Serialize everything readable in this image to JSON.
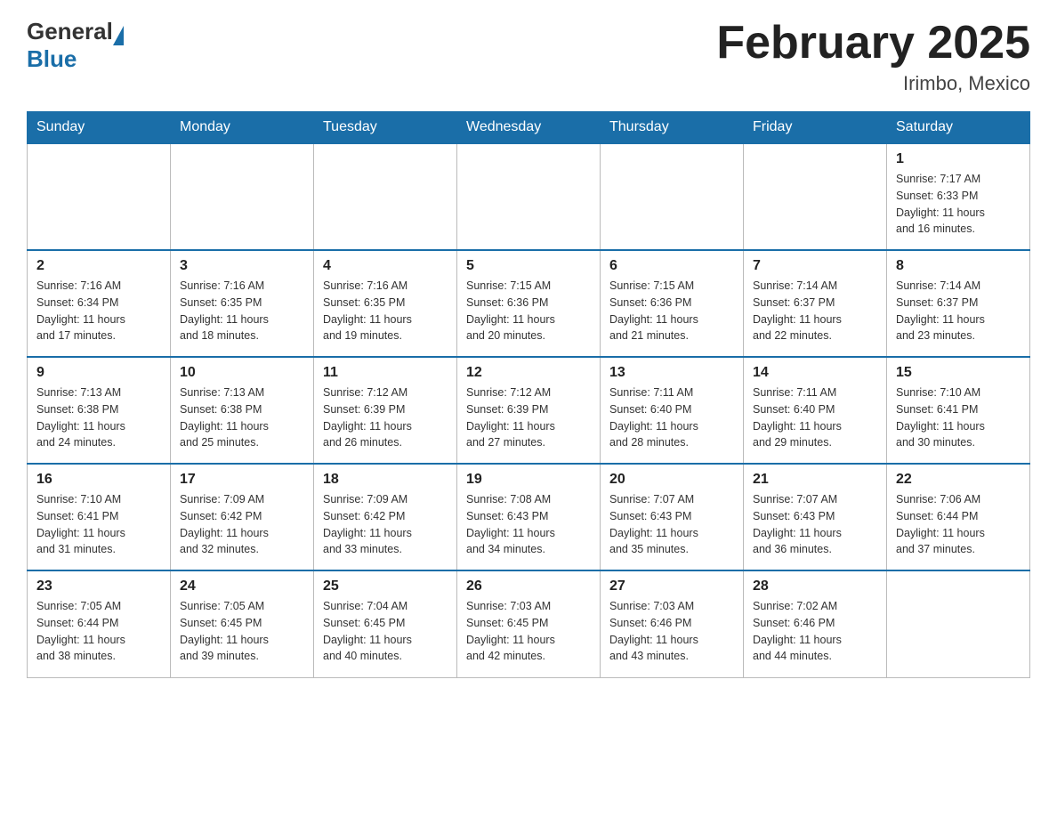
{
  "header": {
    "title": "February 2025",
    "subtitle": "Irimbo, Mexico",
    "logo_general": "General",
    "logo_blue": "Blue"
  },
  "days_of_week": [
    "Sunday",
    "Monday",
    "Tuesday",
    "Wednesday",
    "Thursday",
    "Friday",
    "Saturday"
  ],
  "weeks": [
    [
      {
        "day": "",
        "info": ""
      },
      {
        "day": "",
        "info": ""
      },
      {
        "day": "",
        "info": ""
      },
      {
        "day": "",
        "info": ""
      },
      {
        "day": "",
        "info": ""
      },
      {
        "day": "",
        "info": ""
      },
      {
        "day": "1",
        "info": "Sunrise: 7:17 AM\nSunset: 6:33 PM\nDaylight: 11 hours\nand 16 minutes."
      }
    ],
    [
      {
        "day": "2",
        "info": "Sunrise: 7:16 AM\nSunset: 6:34 PM\nDaylight: 11 hours\nand 17 minutes."
      },
      {
        "day": "3",
        "info": "Sunrise: 7:16 AM\nSunset: 6:35 PM\nDaylight: 11 hours\nand 18 minutes."
      },
      {
        "day": "4",
        "info": "Sunrise: 7:16 AM\nSunset: 6:35 PM\nDaylight: 11 hours\nand 19 minutes."
      },
      {
        "day": "5",
        "info": "Sunrise: 7:15 AM\nSunset: 6:36 PM\nDaylight: 11 hours\nand 20 minutes."
      },
      {
        "day": "6",
        "info": "Sunrise: 7:15 AM\nSunset: 6:36 PM\nDaylight: 11 hours\nand 21 minutes."
      },
      {
        "day": "7",
        "info": "Sunrise: 7:14 AM\nSunset: 6:37 PM\nDaylight: 11 hours\nand 22 minutes."
      },
      {
        "day": "8",
        "info": "Sunrise: 7:14 AM\nSunset: 6:37 PM\nDaylight: 11 hours\nand 23 minutes."
      }
    ],
    [
      {
        "day": "9",
        "info": "Sunrise: 7:13 AM\nSunset: 6:38 PM\nDaylight: 11 hours\nand 24 minutes."
      },
      {
        "day": "10",
        "info": "Sunrise: 7:13 AM\nSunset: 6:38 PM\nDaylight: 11 hours\nand 25 minutes."
      },
      {
        "day": "11",
        "info": "Sunrise: 7:12 AM\nSunset: 6:39 PM\nDaylight: 11 hours\nand 26 minutes."
      },
      {
        "day": "12",
        "info": "Sunrise: 7:12 AM\nSunset: 6:39 PM\nDaylight: 11 hours\nand 27 minutes."
      },
      {
        "day": "13",
        "info": "Sunrise: 7:11 AM\nSunset: 6:40 PM\nDaylight: 11 hours\nand 28 minutes."
      },
      {
        "day": "14",
        "info": "Sunrise: 7:11 AM\nSunset: 6:40 PM\nDaylight: 11 hours\nand 29 minutes."
      },
      {
        "day": "15",
        "info": "Sunrise: 7:10 AM\nSunset: 6:41 PM\nDaylight: 11 hours\nand 30 minutes."
      }
    ],
    [
      {
        "day": "16",
        "info": "Sunrise: 7:10 AM\nSunset: 6:41 PM\nDaylight: 11 hours\nand 31 minutes."
      },
      {
        "day": "17",
        "info": "Sunrise: 7:09 AM\nSunset: 6:42 PM\nDaylight: 11 hours\nand 32 minutes."
      },
      {
        "day": "18",
        "info": "Sunrise: 7:09 AM\nSunset: 6:42 PM\nDaylight: 11 hours\nand 33 minutes."
      },
      {
        "day": "19",
        "info": "Sunrise: 7:08 AM\nSunset: 6:43 PM\nDaylight: 11 hours\nand 34 minutes."
      },
      {
        "day": "20",
        "info": "Sunrise: 7:07 AM\nSunset: 6:43 PM\nDaylight: 11 hours\nand 35 minutes."
      },
      {
        "day": "21",
        "info": "Sunrise: 7:07 AM\nSunset: 6:43 PM\nDaylight: 11 hours\nand 36 minutes."
      },
      {
        "day": "22",
        "info": "Sunrise: 7:06 AM\nSunset: 6:44 PM\nDaylight: 11 hours\nand 37 minutes."
      }
    ],
    [
      {
        "day": "23",
        "info": "Sunrise: 7:05 AM\nSunset: 6:44 PM\nDaylight: 11 hours\nand 38 minutes."
      },
      {
        "day": "24",
        "info": "Sunrise: 7:05 AM\nSunset: 6:45 PM\nDaylight: 11 hours\nand 39 minutes."
      },
      {
        "day": "25",
        "info": "Sunrise: 7:04 AM\nSunset: 6:45 PM\nDaylight: 11 hours\nand 40 minutes."
      },
      {
        "day": "26",
        "info": "Sunrise: 7:03 AM\nSunset: 6:45 PM\nDaylight: 11 hours\nand 42 minutes."
      },
      {
        "day": "27",
        "info": "Sunrise: 7:03 AM\nSunset: 6:46 PM\nDaylight: 11 hours\nand 43 minutes."
      },
      {
        "day": "28",
        "info": "Sunrise: 7:02 AM\nSunset: 6:46 PM\nDaylight: 11 hours\nand 44 minutes."
      },
      {
        "day": "",
        "info": ""
      }
    ]
  ]
}
